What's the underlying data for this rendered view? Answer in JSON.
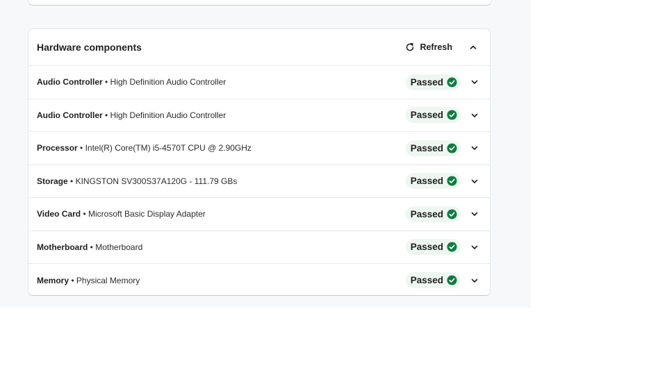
{
  "panel": {
    "title": "Hardware components",
    "refresh_label": "Refresh"
  },
  "components": [
    {
      "name": "Audio Controller",
      "separator": " • ",
      "detail": "High Definition Audio Controller",
      "status": "Passed"
    },
    {
      "name": "Audio Controller",
      "separator": " • ",
      "detail": "High Definition Audio Controller",
      "status": "Passed"
    },
    {
      "name": "Processor",
      "separator": " • ",
      "detail": "Intel(R) Core(TM) i5-4570T CPU @ 2.90GHz",
      "status": "Passed"
    },
    {
      "name": "Storage",
      "separator": " • ",
      "detail": "KINGSTON SV300S37A120G - 111.79 GBs",
      "status": "Passed"
    },
    {
      "name": "Video Card",
      "separator": " • ",
      "detail": "Microsoft Basic Display Adapter",
      "status": "Passed"
    },
    {
      "name": "Motherboard",
      "separator": " • ",
      "detail": "Motherboard",
      "status": "Passed"
    },
    {
      "name": "Memory",
      "separator": " • ",
      "detail": "Physical Memory",
      "status": "Passed"
    }
  ],
  "icons": {
    "refresh": "refresh-icon",
    "collapse": "chevron-up-icon",
    "expand": "chevron-down-icon",
    "status": "check-circle-icon"
  },
  "colors": {
    "success": "#107c41",
    "badge_bg": "#eef6f1",
    "page_bg": "#f6f8fa"
  }
}
